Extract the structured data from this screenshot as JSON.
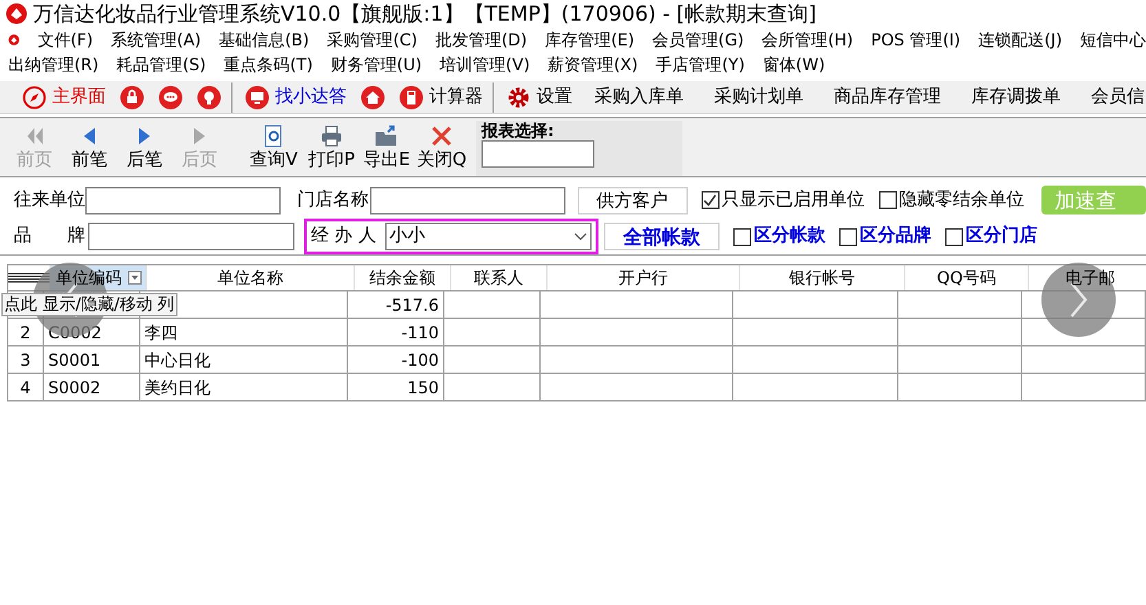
{
  "window": {
    "title": "万信达化妆品行业管理系统V10.0【旗舰版:1】【TEMP】(170906) - [帐款期末查询]"
  },
  "menu_rows": [
    [
      "文件(F)",
      "系统管理(A)",
      "基础信息(B)",
      "采购管理(C)",
      "批发管理(D)",
      "库存管理(E)",
      "会员管理(G)",
      "会所管理(H)",
      "POS 管理(I)",
      "连锁配送(J)",
      "短信中心"
    ],
    [
      "出纳管理(R)",
      "耗品管理(S)",
      "重点条码(T)",
      "财务管理(U)",
      "培训管理(V)",
      "薪资管理(X)",
      "手店管理(Y)",
      "窗体(W)"
    ]
  ],
  "quick_bar": [
    {
      "kind": "compass",
      "label": "主界面",
      "color": "#e00000",
      "separator_after": false
    },
    {
      "kind": "lock",
      "separator_after": false
    },
    {
      "kind": "chat",
      "separator_after": false
    },
    {
      "kind": "bulb",
      "separator_after": true
    },
    {
      "kind": "screen",
      "label": "找小达答",
      "color": "#0000e0",
      "separator_after": false
    },
    {
      "kind": "house",
      "separator_after": false
    },
    {
      "kind": "calc",
      "label": "计算器",
      "color": "#000000",
      "separator_after": true
    },
    {
      "kind": "gear",
      "label": "设置",
      "color": "#000000",
      "separator_after": false
    },
    {
      "kind": "text",
      "label": "采购入库单",
      "color": "#000000",
      "separator_after": false
    },
    {
      "kind": "text",
      "label": "采购计划单",
      "color": "#000000",
      "separator_after": false
    },
    {
      "kind": "text",
      "label": "商品库存管理",
      "color": "#000000",
      "separator_after": false
    },
    {
      "kind": "text",
      "label": "库存调拨单",
      "color": "#000000",
      "separator_after": false
    },
    {
      "kind": "text",
      "label": "会员信",
      "color": "#000000",
      "separator_after": false
    }
  ],
  "tool_bar": [
    {
      "kind": "first",
      "label": "前页",
      "disabled": true
    },
    {
      "kind": "prev",
      "label": "前笔",
      "disabled": false
    },
    {
      "kind": "next",
      "label": "后笔",
      "disabled": false
    },
    {
      "kind": "last",
      "label": "后页",
      "disabled": true
    },
    {
      "kind": "search",
      "label": "查询V",
      "disabled": false
    },
    {
      "kind": "print",
      "label": "打印P",
      "disabled": false
    },
    {
      "kind": "export",
      "label": "导出E",
      "disabled": false
    },
    {
      "kind": "close",
      "label": "关闭Q",
      "disabled": false
    }
  ],
  "report_select": {
    "label": "报表选择:"
  },
  "filters": {
    "partner_label": "往来单位",
    "store_label": "门店名称",
    "brand_label": "品　　牌",
    "handler_label": "经 办 人",
    "handler_value": "小小",
    "supplier_button": "供方客户",
    "all_accounts_button": "全部帐款",
    "quick_query_button": "加速查",
    "options": [
      {
        "label": "只显示已启用单位",
        "checked": true,
        "emphasis": false
      },
      {
        "label": "隐藏零结余单位",
        "checked": false,
        "emphasis": false
      },
      {
        "label": "区分帐款",
        "checked": false,
        "emphasis": true
      },
      {
        "label": "区分品牌",
        "checked": false,
        "emphasis": true
      },
      {
        "label": "区分门店",
        "checked": false,
        "emphasis": true
      }
    ]
  },
  "table": {
    "columns": [
      "单位编码",
      "单位名称",
      "结余金额",
      "联系人",
      "开户行",
      "银行帐号",
      "QQ号码",
      "电子邮"
    ],
    "column_hint": "点此 显示/隐藏/移动 列",
    "rows": [
      {
        "no": "",
        "cells": [
          "",
          "",
          "-517.6",
          "",
          "",
          "",
          "",
          ""
        ]
      },
      {
        "no": "2",
        "cells": [
          "C0002",
          "李四",
          "-110",
          "",
          "",
          "",
          "",
          ""
        ]
      },
      {
        "no": "3",
        "cells": [
          "S0001",
          "中心日化",
          "-100",
          "",
          "",
          "",
          "",
          ""
        ]
      },
      {
        "no": "4",
        "cells": [
          "S0002",
          "美约日化",
          "150",
          "",
          "",
          "",
          "",
          ""
        ]
      }
    ]
  }
}
